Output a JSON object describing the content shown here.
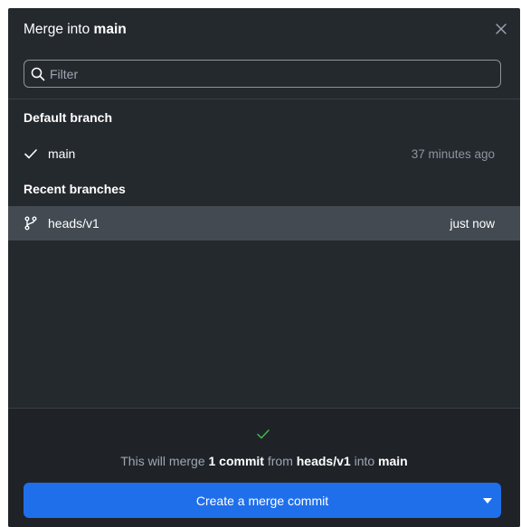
{
  "dialog": {
    "title_prefix": "Merge into ",
    "title_branch": "main",
    "close_icon": "close-icon"
  },
  "filter": {
    "placeholder": "Filter",
    "value": ""
  },
  "sections": {
    "default_label": "Default branch",
    "recent_label": "Recent branches"
  },
  "default_branch": {
    "name": "main",
    "time": "37 minutes ago",
    "icon": "check-icon"
  },
  "recent_branches": [
    {
      "name": "heads/v1",
      "time": "just now",
      "icon": "git-branch-icon",
      "selected": true
    }
  ],
  "footer": {
    "status_icon": "check-icon",
    "msg_part1": "This will merge ",
    "msg_count": "1 commit",
    "msg_part2": " from ",
    "msg_source": "heads/v1",
    "msg_part3": " into ",
    "msg_target": "main",
    "button_label": "Create a merge commit",
    "dropdown_icon": "caret-down-icon"
  },
  "colors": {
    "background": "#24292e",
    "selected_row": "#434a52",
    "footer_background": "#1f2328",
    "primary_button": "#1f6feb",
    "success_check": "#3fb950",
    "muted_text": "#8b949e"
  }
}
